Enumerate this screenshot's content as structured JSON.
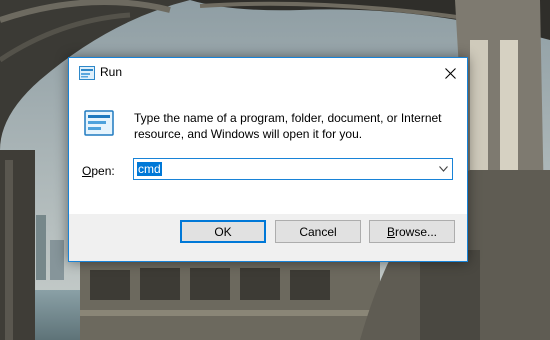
{
  "window": {
    "title": "Run",
    "icon": "run-icon",
    "close_icon": "close-icon"
  },
  "dialog": {
    "description": "Type the name of a program, folder, document, or Internet resource, and Windows will open it for you.",
    "open_label_accel": "O",
    "open_label_rest": "pen:",
    "open_value": "cmd",
    "dropdown_icon": "chevron-down-icon"
  },
  "buttons": {
    "ok": "OK",
    "cancel": "Cancel",
    "browse_accel": "B",
    "browse_rest": "rowse..."
  },
  "colors": {
    "accent": "#0078d7",
    "border": "#1883d7",
    "dialog_bg": "#f0f0f0",
    "button_bg": "#e1e1e1"
  }
}
